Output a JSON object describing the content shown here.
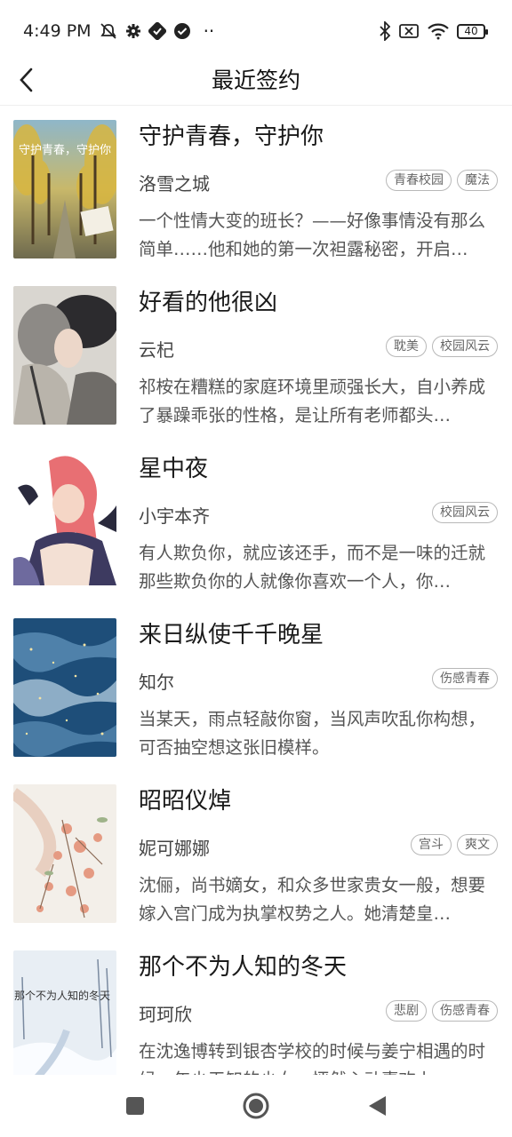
{
  "status_bar": {
    "time": "4:49 PM",
    "dots": "··",
    "battery": "40"
  },
  "header": {
    "title": "最近签约",
    "back_icon": "chevron-left-icon"
  },
  "books": [
    {
      "title": "守护青春，守护你",
      "author": "洛雪之城",
      "tags": [
        "青春校园",
        "魔法"
      ],
      "description": "一个性情大变的班长？——好像事情没有那么简单……他和她的第一次袒露秘密，开启…",
      "cover_text": "守护青春，守护你"
    },
    {
      "title": "好看的他很凶",
      "author": "云杞",
      "tags": [
        "耽美",
        "校园风云"
      ],
      "description": "祁桉在糟糕的家庭环境里顽强长大，自小养成了暴躁乖张的性格，是让所有老师都头…"
    },
    {
      "title": "星中夜",
      "author": "小宇本齐",
      "tags": [
        "校园风云"
      ],
      "description": "有人欺负你，就应该还手，而不是一味的迁就那些欺负你的人就像你喜欢一个人，你…"
    },
    {
      "title": "来日纵使千千晚星",
      "author": "知尔",
      "tags": [
        "伤感青春"
      ],
      "description": "当某天，雨点轻敲你窗，当风声吹乱你构想，可否抽空想这张旧模样。"
    },
    {
      "title": "昭昭仪焯",
      "author": "妮可娜娜",
      "tags": [
        "宫斗",
        "爽文"
      ],
      "description": "沈俪，尚书嫡女，和众多世家贵女一般，想要嫁入宫门成为执掌权势之人。她清楚皇…"
    },
    {
      "title": "那个不为人知的冬天",
      "author": "珂珂欣",
      "tags": [
        "悲剧",
        "伤感青春"
      ],
      "description": "在沈逸博转到银杏学校的时候与姜宁相遇的时候，年少无知的少女，怦然心动喜欢上…",
      "cover_text": "那个不为人知的冬天"
    }
  ],
  "nav_bar": {
    "items": [
      "recent-apps-icon",
      "home-icon",
      "back-icon"
    ]
  }
}
